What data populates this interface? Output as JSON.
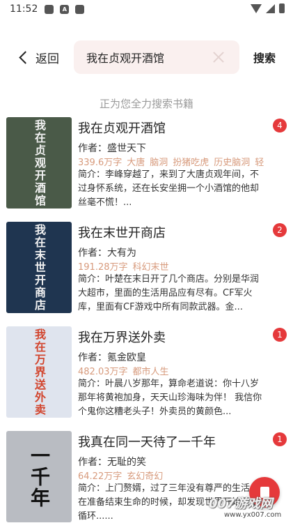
{
  "status_bar": {
    "time": "11:52",
    "icons": [
      "gallery-icon",
      "a-icon",
      "notification-icon",
      "wifi-icon",
      "signal-icon",
      "battery-icon"
    ]
  },
  "header": {
    "back_label": "返回",
    "search_value": "我在贞观开酒馆",
    "search_button": "搜索"
  },
  "searching_tip": "正为您全力搜索书籍",
  "books": [
    {
      "title": "我在贞观开酒馆",
      "badge": "4",
      "author": "作者：盛世天下",
      "meta": [
        "339.6万字",
        "大唐",
        "脑洞",
        "扮猪吃虎",
        "历史脑洞",
        "轻"
      ],
      "summary": "简介：李峰穿越了，来到了大唐贞观年间，不过身怀系统，还在长安坐拥一个小酒馆的他却丝毫不慌！...",
      "cover_text": "我在贞观开酒馆",
      "cover_color": "#4a5a48"
    },
    {
      "title": "我在末世开商店",
      "badge": "2",
      "author": "作者：大有为",
      "meta": [
        "191.28万字",
        "科幻末世"
      ],
      "summary": "简介：叶楚在末日开了几个商店。分别是华润大超市，里面的生活用品应有尽有。CF军火库，里面有CF游戏中所有同款武器。金...",
      "cover_text": "我在末世开商店",
      "cover_color": "#1f3550"
    },
    {
      "title": "我在万界送外卖",
      "badge": "1",
      "author": "作者：氪金欧皇",
      "meta": [
        "482.03万字",
        "都市人生"
      ],
      "summary": "简介：叶晨八岁那年，算命老道说：你十八岁那年将黄袍加身，天天山珍海味为伴！ 我信你个鬼你这糟老头子！外卖员的黄颜色...",
      "cover_text": "我在万界送外卖",
      "cover_color": "#dfe4ee"
    },
    {
      "title": "我真在同一天待了一千年",
      "badge": "1",
      "author": "作者：无耻的笑",
      "meta": [
        "64.22万字",
        "玄幻奇幻"
      ],
      "summary": "简介：上门赘婿，过了三年没有尊严的生活，在准备结束生命的时候，却发现世界开始无限循环......",
      "cover_text": "一千年",
      "cover_color": "#b9bcc2"
    }
  ],
  "fab": {
    "icon": "book-icon",
    "color": "#e5393b"
  },
  "watermark": {
    "text": "007游戏网",
    "url": "www.yx007.com"
  },
  "colors": {
    "accent": "#e5393b",
    "meta": "#d79a7c",
    "search_bg": "#faf0ef"
  }
}
